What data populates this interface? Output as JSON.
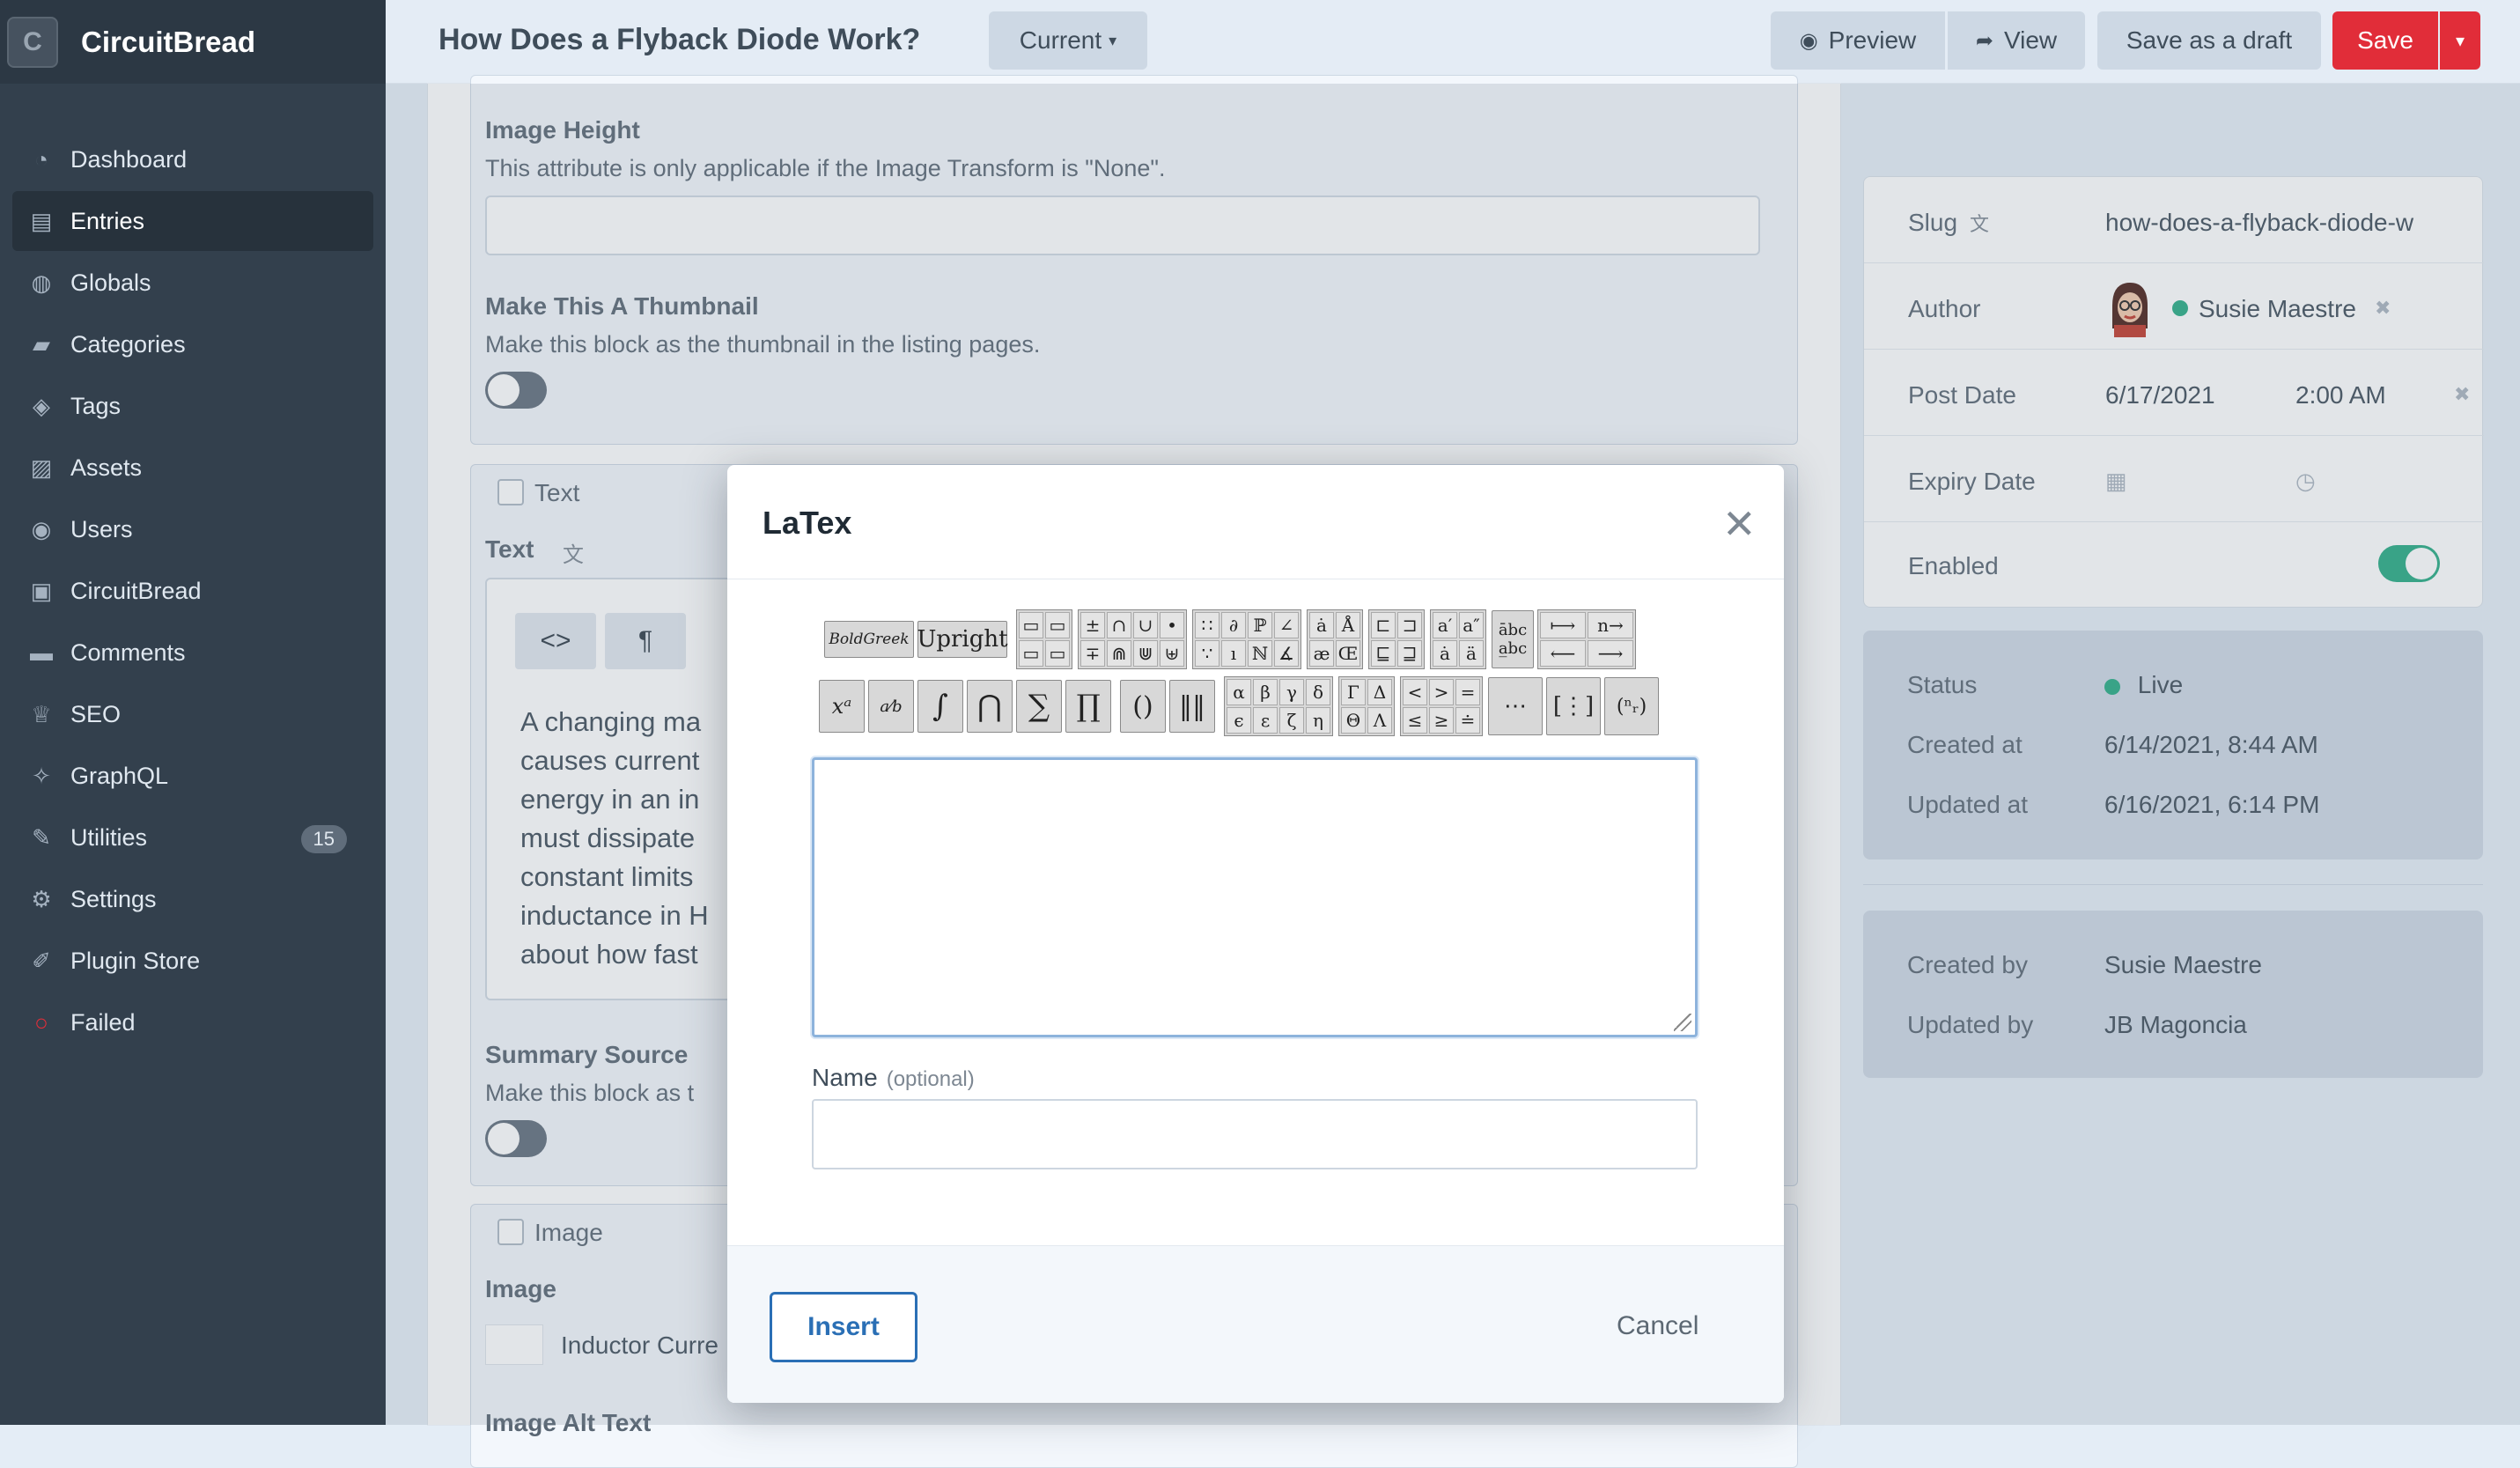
{
  "app": {
    "name": "CircuitBread",
    "logo_letter": "C"
  },
  "sidebar": {
    "items": [
      {
        "label": "Dashboard",
        "icon": "dashboard-icon",
        "glyph": "◔"
      },
      {
        "label": "Entries",
        "icon": "entries-icon",
        "glyph": "▤",
        "active": true
      },
      {
        "label": "Globals",
        "icon": "globe-icon",
        "glyph": "◍"
      },
      {
        "label": "Categories",
        "icon": "folder-icon",
        "glyph": "▰"
      },
      {
        "label": "Tags",
        "icon": "tag-icon",
        "glyph": "◈"
      },
      {
        "label": "Assets",
        "icon": "image-icon",
        "glyph": "▨"
      },
      {
        "label": "Users",
        "icon": "users-icon",
        "glyph": "◉"
      },
      {
        "label": "CircuitBread",
        "icon": "plugin-icon",
        "glyph": "▣"
      },
      {
        "label": "Comments",
        "icon": "comment-icon",
        "glyph": "▬"
      },
      {
        "label": "SEO",
        "icon": "trophy-icon",
        "glyph": "♕"
      },
      {
        "label": "GraphQL",
        "icon": "graphql-icon",
        "glyph": "✧"
      },
      {
        "label": "Utilities",
        "icon": "wrench-icon",
        "glyph": "✎",
        "badge": "15"
      },
      {
        "label": "Settings",
        "icon": "gear-icon",
        "glyph": "⚙"
      },
      {
        "label": "Plugin Store",
        "icon": "plug-icon",
        "glyph": "✐"
      },
      {
        "label": "Failed",
        "icon": "failed-icon",
        "glyph": "○"
      }
    ]
  },
  "header": {
    "title": "How Does a Flyback Diode Work?",
    "revision": "Current",
    "preview": "Preview",
    "view": "View",
    "save_draft": "Save as a draft",
    "save": "Save"
  },
  "form": {
    "image_height": {
      "label": "Image Height",
      "help": "This attribute is only applicable if the Image Transform is \"None\"."
    },
    "thumbnail": {
      "label": "Make This A Thumbnail",
      "help": "Make this block as the thumbnail in the listing pages."
    },
    "text_block": {
      "title": "Text",
      "field_label": "Text",
      "btn_code": "<>",
      "btn_para": "¶",
      "lines": [
        "A changing ma",
        "causes current",
        "energy in an in",
        "must dissipate",
        "constant limits",
        "inductance in H",
        "about how fast"
      ]
    },
    "summary": {
      "label": "Summary Source",
      "help": "Make this block as t"
    },
    "image_block": {
      "title": "Image",
      "field_label": "Image",
      "asset_name": "Inductor Curre"
    },
    "partial_label": "Image Alt Text"
  },
  "meta": {
    "slug_label": "Slug",
    "slug_value": "how-does-a-flyback-diode-w",
    "author_label": "Author",
    "author_name": "Susie Maestre",
    "post_date_label": "Post Date",
    "post_date": "6/17/2021",
    "post_time": "2:00 AM",
    "expiry_label": "Expiry Date",
    "enabled_label": "Enabled",
    "status_label": "Status",
    "status_value": "Live",
    "created_at_label": "Created at",
    "created_at": "6/14/2021, 8:44 AM",
    "updated_at_label": "Updated at",
    "updated_at": "6/16/2021, 6:14 PM",
    "created_by_label": "Created by",
    "created_by": "Susie Maestre",
    "updated_by_label": "Updated by",
    "updated_by": "JB Magoncia"
  },
  "modal": {
    "title": "LaTex",
    "close": "✕",
    "toolbar_row1": [
      "BoldGreek",
      "Upright"
    ],
    "name_label": "Name",
    "name_optional": "(optional)",
    "insert": "Insert",
    "cancel": "Cancel"
  },
  "colors": {
    "sidebar": "#33404d",
    "accent": "#e12d39",
    "link": "#2a6fb5",
    "live": "#27ab83"
  }
}
